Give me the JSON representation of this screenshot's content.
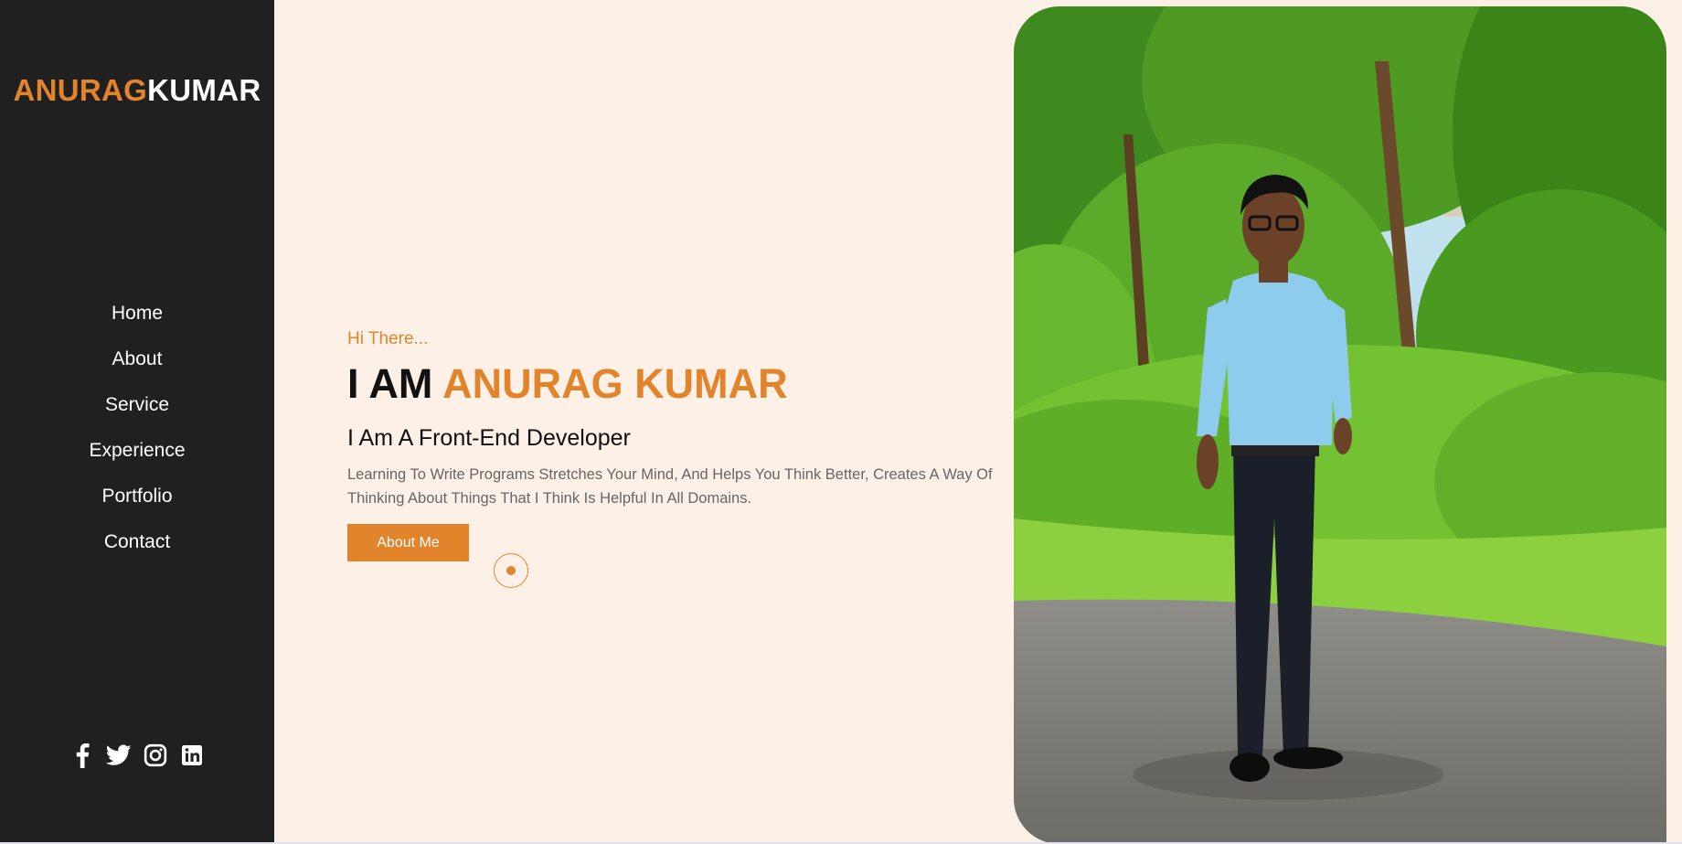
{
  "logo": {
    "first": "ANURAG",
    "last": "KUMAR"
  },
  "nav": {
    "items": [
      {
        "label": "Home"
      },
      {
        "label": "About"
      },
      {
        "label": "Service"
      },
      {
        "label": "Experience"
      },
      {
        "label": "Portfolio"
      },
      {
        "label": "Contact"
      }
    ]
  },
  "socials": [
    "facebook-icon",
    "twitter-icon",
    "instagram-icon",
    "linkedin-icon"
  ],
  "hero": {
    "greeting": "Hi There...",
    "headline_prefix": "I AM",
    "headline_name": "ANURAG KUMAR",
    "role": "I Am A Front-End Developer",
    "description": "Learning To Write Programs Stretches Your Mind, And Helps You Think Better, Creates A Way Of Thinking About Things That I Think Is Helpful In All Domains.",
    "button_label": "About Me"
  },
  "colors": {
    "accent": "#e2842c",
    "sidebar_bg": "#202020",
    "page_bg": "#fdf0e6"
  }
}
